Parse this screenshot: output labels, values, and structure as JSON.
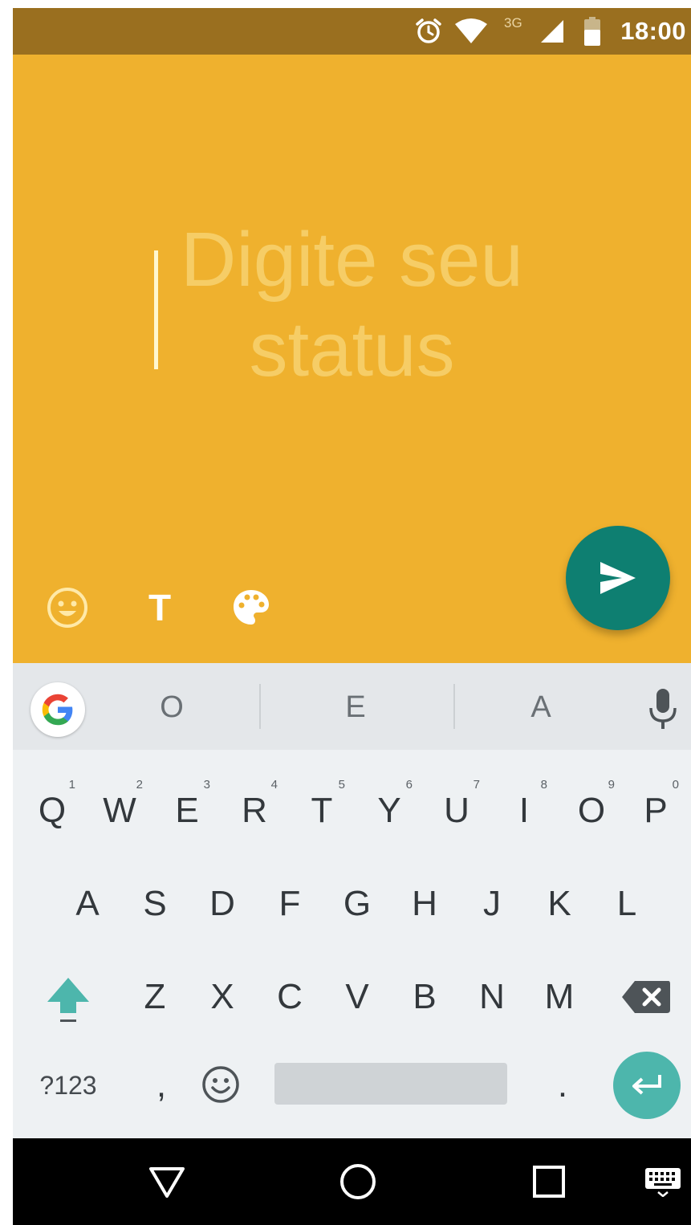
{
  "status_bar": {
    "time": "18:00",
    "network": "3G",
    "icons": [
      "alarm-icon",
      "wifi-icon",
      "cell-signal-icon",
      "battery-icon"
    ]
  },
  "composer": {
    "placeholder_line1": "Digite seu",
    "placeholder_line2": "status",
    "background_color": "#efb12e",
    "tools": [
      {
        "name": "emoji-icon"
      },
      {
        "name": "text-style",
        "label": "T"
      },
      {
        "name": "palette-icon"
      }
    ],
    "send_button": {
      "icon": "send-icon",
      "color": "#0e7f71"
    }
  },
  "keyboard": {
    "suggestions": [
      "O",
      "E",
      "A"
    ],
    "row1": [
      {
        "key": "Q",
        "hint": "1"
      },
      {
        "key": "W",
        "hint": "2"
      },
      {
        "key": "E",
        "hint": "3"
      },
      {
        "key": "R",
        "hint": "4"
      },
      {
        "key": "T",
        "hint": "5"
      },
      {
        "key": "Y",
        "hint": "6"
      },
      {
        "key": "U",
        "hint": "7"
      },
      {
        "key": "I",
        "hint": "8"
      },
      {
        "key": "O",
        "hint": "9"
      },
      {
        "key": "P",
        "hint": "0"
      }
    ],
    "row2": [
      "A",
      "S",
      "D",
      "F",
      "G",
      "H",
      "J",
      "K",
      "L"
    ],
    "row3": [
      "Z",
      "X",
      "C",
      "V",
      "B",
      "N",
      "M"
    ],
    "row4": {
      "symbols": "?123",
      "comma": ",",
      "period": "."
    },
    "accent_color": "#4db6ac"
  },
  "navigation": [
    "back-icon",
    "home-icon",
    "recents-icon",
    "keyboard-switch-icon"
  ]
}
